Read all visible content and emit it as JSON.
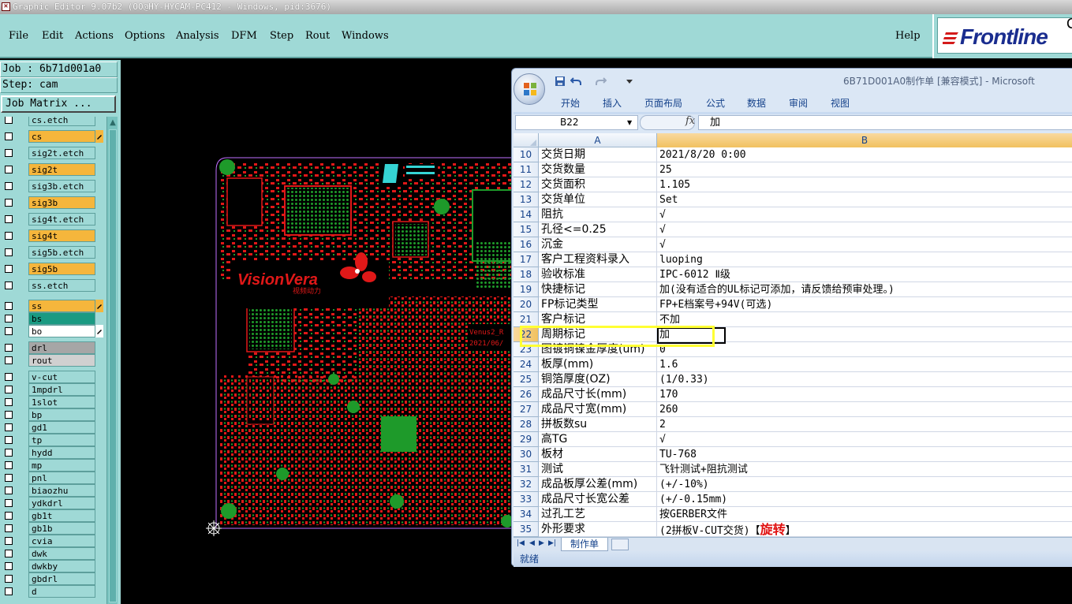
{
  "genesis": {
    "window_title": "Graphic Editor 9.07b2 (OO@HY-HYCAM-PC412 - Windows, pid:3676)",
    "menu": [
      "File",
      "Edit",
      "Actions",
      "Options",
      "Analysis",
      "DFM",
      "Step",
      "Rout",
      "Windows"
    ],
    "help": "Help",
    "logo_text": "Frontline",
    "logo_trailing": "C",
    "job_label": "Job : 6b71d001a0",
    "step_label": "Step: cam",
    "job_matrix_label": "Job Matrix ...",
    "layers": [
      {
        "name": "cs.etch",
        "color": "#9fd9d6"
      },
      {
        "name": "cs",
        "color": "#f5b63c",
        "side": "top"
      },
      {
        "name": "sig2t.etch",
        "color": "#9fd9d6"
      },
      {
        "name": "sig2t",
        "color": "#f5b63c"
      },
      {
        "name": "sig3b.etch",
        "color": "#9fd9d6"
      },
      {
        "name": "sig3b",
        "color": "#f5b63c"
      },
      {
        "name": "sig4t.etch",
        "color": "#9fd9d6"
      },
      {
        "name": "sig4t",
        "color": "#f5b63c"
      },
      {
        "name": "sig5b.etch",
        "color": "#9fd9d6"
      },
      {
        "name": "sig5b",
        "color": "#f5b63c"
      },
      {
        "name": "ss.etch",
        "color": "#9fd9d6"
      },
      {
        "name": "ss",
        "color": "#f5b63c",
        "side": "bottom"
      },
      {
        "name": "bs",
        "color": "#1a9a82"
      },
      {
        "name": "bo",
        "color": "#ffffff",
        "side": "bottom"
      },
      {
        "name": "drl",
        "color": "#a6a6a6"
      },
      {
        "name": "rout",
        "color": "#d0d0d0"
      },
      {
        "name": "v-cut",
        "color": "#9fd9d6"
      },
      {
        "name": "1mpdrl",
        "color": "#9fd9d6"
      },
      {
        "name": "1slot",
        "color": "#9fd9d6"
      },
      {
        "name": "bp",
        "color": "#9fd9d6"
      },
      {
        "name": "gd1",
        "color": "#9fd9d6"
      },
      {
        "name": "tp",
        "color": "#9fd9d6"
      },
      {
        "name": "hydd",
        "color": "#9fd9d6"
      },
      {
        "name": "mp",
        "color": "#9fd9d6"
      },
      {
        "name": "pnl",
        "color": "#9fd9d6"
      },
      {
        "name": "biaozhu",
        "color": "#9fd9d6"
      },
      {
        "name": "ydkdrl",
        "color": "#9fd9d6"
      },
      {
        "name": "gb1t",
        "color": "#9fd9d6"
      },
      {
        "name": "gb1b",
        "color": "#9fd9d6"
      },
      {
        "name": "cvia",
        "color": "#9fd9d6"
      },
      {
        "name": "dwk",
        "color": "#9fd9d6"
      },
      {
        "name": "dwkby",
        "color": "#9fd9d6"
      },
      {
        "name": "gbdrl",
        "color": "#9fd9d6"
      },
      {
        "name": "d",
        "color": "#9fd9d6"
      }
    ],
    "pcb_texts": {
      "brand": "VisionVera",
      "brand_cn": "视频动力",
      "rev": "Venus2_R",
      "date": "2021/06/"
    }
  },
  "excel": {
    "title": "6B71D001A0制作单 [兼容模式] - Microsoft",
    "ribbon_tabs": [
      "开始",
      "插入",
      "页面布局",
      "公式",
      "数据",
      "审阅",
      "视图"
    ],
    "name_box": "B22",
    "fx": "fx",
    "formula": "加",
    "columns": [
      "A",
      "B"
    ],
    "selected_row": "22",
    "rows": [
      {
        "n": "10",
        "a": "交货日期",
        "b": "2021/8/20 0:00"
      },
      {
        "n": "11",
        "a": "交货数量",
        "b": "25"
      },
      {
        "n": "12",
        "a": "交货面积",
        "b": "1.105"
      },
      {
        "n": "13",
        "a": "交货单位",
        "b": "Set"
      },
      {
        "n": "14",
        "a": "阻抗",
        "b": "√"
      },
      {
        "n": "15",
        "a": "孔径<=0.25",
        "b": "√"
      },
      {
        "n": "16",
        "a": "沉金",
        "b": "√"
      },
      {
        "n": "17",
        "a": "客户工程资料录入",
        "b": "luoping"
      },
      {
        "n": "18",
        "a": "验收标准",
        "b": "IPC-6012 Ⅱ级"
      },
      {
        "n": "19",
        "a": "快捷标记",
        "b": "加(没有适合的UL标记可添加，请反馈给预审处理。)"
      },
      {
        "n": "20",
        "a": "FP标记类型",
        "b": "FP+E档案号+94V(可选)"
      },
      {
        "n": "21",
        "a": "客户标记",
        "b": "不加"
      },
      {
        "n": "22",
        "a": "周期标记",
        "b": "加"
      },
      {
        "n": "23",
        "a": "图镀铜镍金厚度(um)",
        "b": "0"
      },
      {
        "n": "24",
        "a": "板厚(mm)",
        "b": "1.6"
      },
      {
        "n": "25",
        "a": "铜箔厚度(OZ)",
        "b": " (1/0.33)"
      },
      {
        "n": "26",
        "a": "成品尺寸长(mm)",
        "b": "170"
      },
      {
        "n": "27",
        "a": "成品尺寸宽(mm)",
        "b": "260"
      },
      {
        "n": "28",
        "a": "拼板数su",
        "b": "2"
      },
      {
        "n": "29",
        "a": "高TG",
        "b": "√"
      },
      {
        "n": "30",
        "a": "板材",
        "b": "TU-768"
      },
      {
        "n": "31",
        "a": "测试",
        "b": "飞针测试+阻抗测试"
      },
      {
        "n": "32",
        "a": "成品板厚公差(mm)",
        "b": "(+/-10%)"
      },
      {
        "n": "33",
        "a": "成品尺寸长宽公差",
        "b": "(+/-0.15mm)"
      },
      {
        "n": "34",
        "a": "过孔工艺",
        "b": "按GERBER文件"
      },
      {
        "n": "35",
        "a": "外形要求",
        "b": "(2拼板V-CUT交货)【",
        "b_red": "旋转",
        "b_tail": "】"
      }
    ],
    "sheet_tab": "制作单",
    "status": "就绪"
  }
}
